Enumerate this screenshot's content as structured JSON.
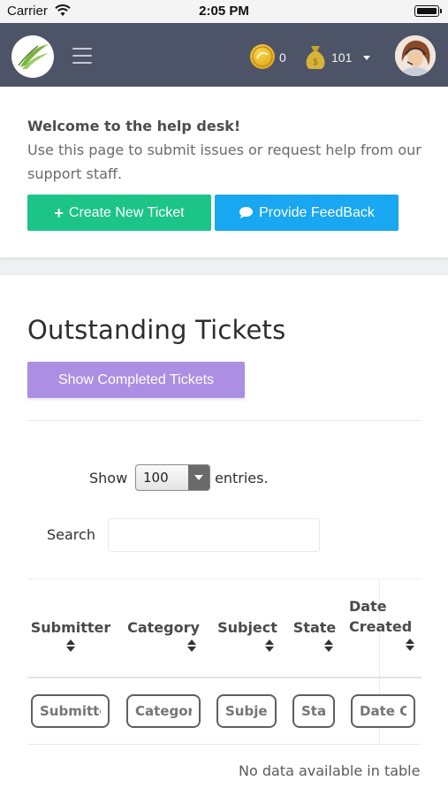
{
  "status_bar": {
    "carrier": "Carrier",
    "time": "2:05 PM"
  },
  "header": {
    "coins": "0",
    "bag_count": "101"
  },
  "welcome": {
    "title": "Welcome to the help desk!",
    "text": "Use this page to submit issues or request help from our support staff.",
    "create_ticket_label": "Create New Ticket",
    "feedback_label": "Provide FeedBack"
  },
  "tickets": {
    "title": "Outstanding Tickets",
    "show_completed_label": "Show Completed Tickets",
    "show_label": "Show",
    "entries_value": "100",
    "entries_label": "entries.",
    "search_label": "Search",
    "columns": [
      {
        "label": "Submitter",
        "filter_placeholder": "Submitter"
      },
      {
        "label": "Category",
        "filter_placeholder": "Category"
      },
      {
        "label": "Subject",
        "filter_placeholder": "Subject"
      },
      {
        "label": "State",
        "filter_placeholder": "State"
      },
      {
        "label": "Date Created",
        "label_line1": "Date",
        "label_line2": "Created",
        "filter_placeholder": "Date Created"
      }
    ],
    "empty_message": "No data available in table"
  },
  "colors": {
    "appbar": "#4e5467",
    "create_button": "#1cc488",
    "feedback_button": "#18a7f0",
    "completed_button": "#ac8fe2"
  },
  "icons": {
    "logo": "leaf-logo-icon",
    "menu": "hamburger-icon",
    "coin": "coin-icon",
    "bag": "money-bag-icon",
    "caret": "caret-down-icon",
    "plus": "plus-icon",
    "comment": "comment-icon"
  }
}
